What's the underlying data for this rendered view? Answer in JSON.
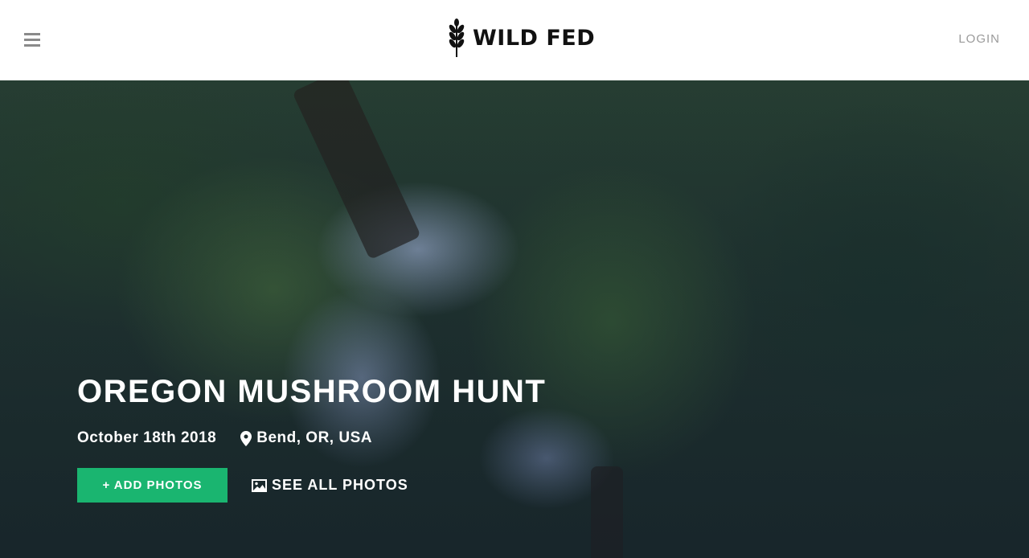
{
  "header": {
    "logo_text": "WILD FED",
    "login_label": "LOGIN",
    "icons": {
      "menu": "hamburger-menu-icon",
      "logo": "wheat-leaf-logo-icon"
    }
  },
  "hero": {
    "title": "OREGON MUSHROOM HUNT",
    "date": "October 18th 2018",
    "location": "Bend, OR, USA",
    "add_photos_label": "+ ADD PHOTOS",
    "see_all_label": "SEE ALL PHOTOS",
    "icons": {
      "location": "map-pin-icon",
      "gallery": "image-icon"
    }
  },
  "colors": {
    "accent": "#1ab570",
    "login": "#9a9a9a",
    "menu_icon": "#8a8a8a"
  }
}
